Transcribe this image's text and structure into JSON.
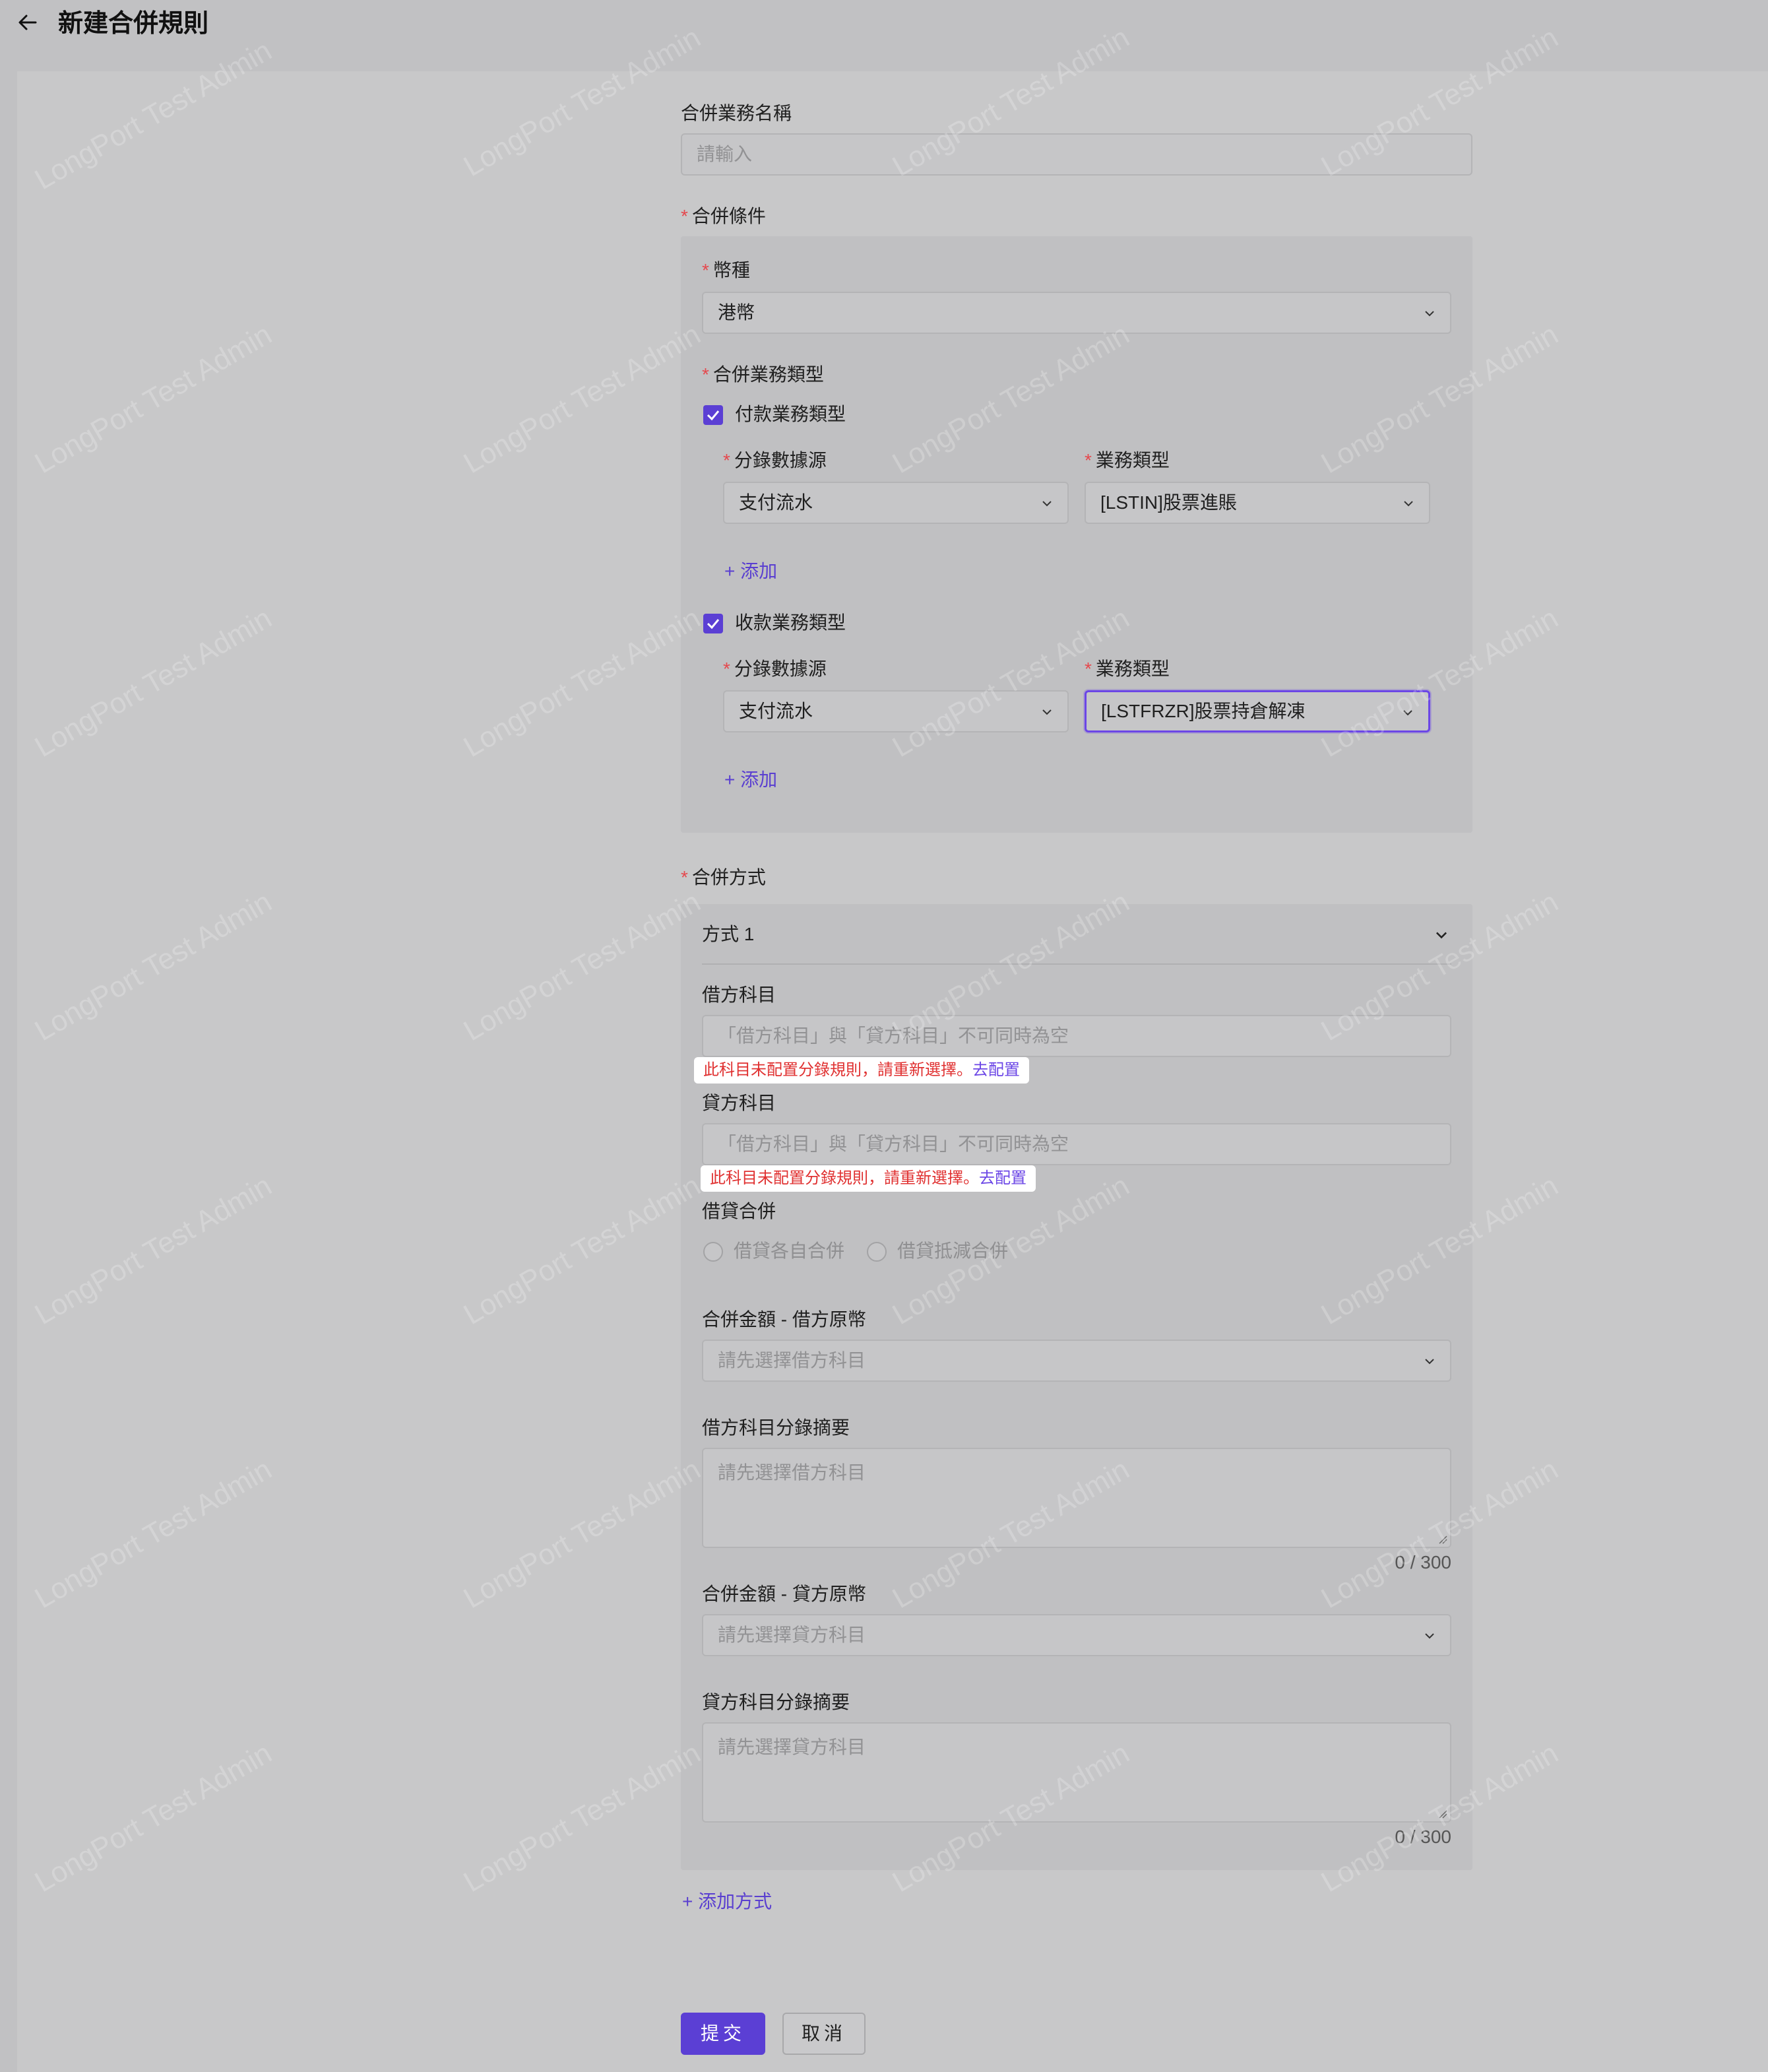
{
  "header": {
    "title": "新建合併規則"
  },
  "form": {
    "name_label": "合併業務名稱",
    "name_placeholder": "請輸入",
    "conditions_label": "合併條件",
    "currency_label": "幣種",
    "currency_value": "港幣",
    "biz_type_label": "合併業務類型",
    "payment": {
      "checkbox_label": "付款業務類型",
      "source_label": "分錄數據源",
      "source_value": "支付流水",
      "type_label": "業務類型",
      "type_value": "[LSTIN]股票進賬",
      "add_label": "+ 添加"
    },
    "receipt": {
      "checkbox_label": "收款業務類型",
      "source_label": "分錄數據源",
      "source_value": "支付流水",
      "type_label": "業務類型",
      "type_value": "[LSTFRZR]股票持倉解凍",
      "add_label": "+ 添加"
    },
    "method_label": "合併方式",
    "method": {
      "title": "方式 1",
      "debit_label": "借方科目",
      "debit_placeholder": "「借方科目」與「貸方科目」不可同時為空",
      "debit_error": "此科目未配置分錄規則，請重新選擇。",
      "debit_error_link": "去配置",
      "credit_label": "貸方科目",
      "credit_placeholder": "「借方科目」與「貸方科目」不可同時為空",
      "credit_error": "此科目未配置分錄規則，請重新選擇。",
      "credit_error_link": "去配置",
      "merge_label": "借貸合併",
      "merge_option_1": "借貸各自合併",
      "merge_option_2": "借貸抵減合併",
      "debit_amount_label": "合併金額 - 借方原幣",
      "debit_amount_placeholder": "請先選擇借方科目",
      "debit_summary_label": "借方科目分錄摘要",
      "debit_summary_placeholder": "請先選擇借方科目",
      "debit_summary_count": "0 / 300",
      "credit_amount_label": "合併金額 - 貸方原幣",
      "credit_amount_placeholder": "請先選擇貸方科目",
      "credit_summary_label": "貸方科目分錄摘要",
      "credit_summary_placeholder": "請先選擇貸方科目",
      "credit_summary_count": "0 / 300"
    },
    "add_method_label": "+ 添加方式",
    "submit_label": "提交",
    "cancel_label": "取消"
  },
  "watermark": "LongPort Test Admin",
  "colors": {
    "accent": "#5b3fd4",
    "error": "#e03131",
    "required": "#e5484d"
  }
}
